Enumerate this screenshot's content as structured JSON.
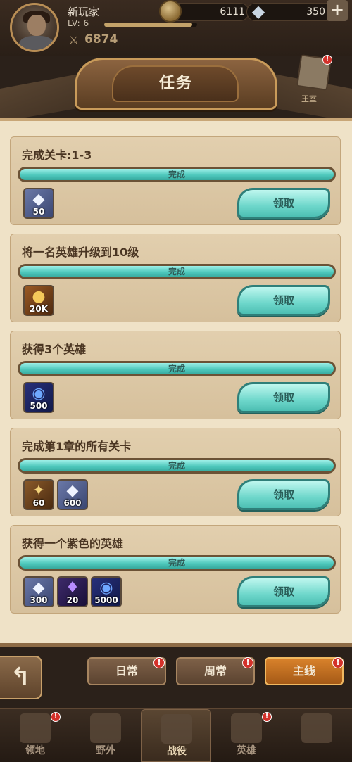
{
  "player": {
    "name": "新玩家",
    "level": "LV: 6",
    "level_progress": 0.95,
    "power": "6874",
    "gold": "6111",
    "gems": "350",
    "plus": "+"
  },
  "header": {
    "title": "任务",
    "scroll_label": "王室",
    "scroll_badge": "!"
  },
  "progress_text": "完成",
  "claim_label": "领取",
  "tasks": [
    {
      "title": "完成关卡:1-3",
      "progress": 1.0,
      "rewards": [
        {
          "icon": "diamond-icon",
          "qty": "50"
        }
      ]
    },
    {
      "title": "将一名英雄升级到10级",
      "progress": 1.0,
      "rewards": [
        {
          "icon": "gold-coin-icon",
          "qty": "20K"
        }
      ]
    },
    {
      "title": "获得3个英雄",
      "progress": 1.0,
      "rewards": [
        {
          "icon": "hero-essence-icon",
          "qty": "500"
        }
      ]
    },
    {
      "title": "完成第1章的所有关卡",
      "progress": 1.0,
      "rewards": [
        {
          "icon": "vip-scroll-icon",
          "qty": "60"
        },
        {
          "icon": "diamond-icon",
          "qty": "600"
        }
      ]
    },
    {
      "title": "获得一个紫色的英雄",
      "progress": 1.0,
      "rewards": [
        {
          "icon": "diamond-icon",
          "qty": "300"
        },
        {
          "icon": "purple-crystal-icon",
          "qty": "20"
        },
        {
          "icon": "hero-essence-icon",
          "qty": "5000"
        }
      ]
    }
  ],
  "tabs": [
    {
      "label": "日常",
      "badge": "!"
    },
    {
      "label": "周常",
      "badge": "!"
    },
    {
      "label": "主线",
      "badge": "!"
    }
  ],
  "nav": [
    {
      "label": "领地",
      "badge": "!"
    },
    {
      "label": "野外",
      "badge": ""
    },
    {
      "label": "战役",
      "badge": ""
    },
    {
      "label": "英雄",
      "badge": "!"
    },
    {
      "label": "",
      "badge": ""
    }
  ],
  "colors": {
    "progress": "#4fc9bd",
    "claim": "#6ed7cb",
    "active_tab": "#d9822b",
    "badge": "#d3312a"
  }
}
